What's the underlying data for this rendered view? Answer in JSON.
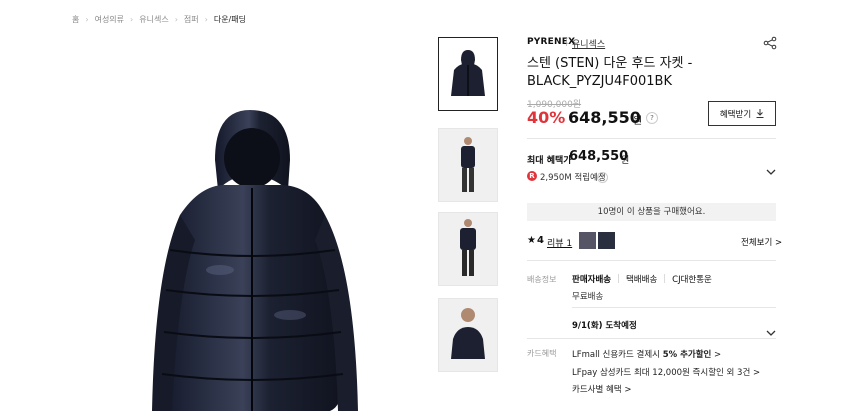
{
  "breadcrumb": [
    "홈",
    "여성의류",
    "유니섹스",
    "점퍼",
    "다운/패딩"
  ],
  "product": {
    "brand": "PYRENEX",
    "sub_brand": "유니섹스",
    "title": "스텐 (STEN) 다운 후드 자켓 - BLACK_PYZJU4F001BK",
    "original_price": "1,090,000원",
    "discount": "40%",
    "price": "648,550",
    "currency": "원"
  },
  "benefit_button": "혜택받기",
  "max_benefit": {
    "label": "최대 혜택가",
    "price": "648,550",
    "currency": "원"
  },
  "points": {
    "badge": "R",
    "text": "2,950M 적립예정"
  },
  "buyers_banner": "10명이 이 상품을 구매했어요.",
  "review": {
    "rating": "4",
    "link": "리뷰 1",
    "view_all": "전체보기 >"
  },
  "shipping": {
    "label": "배송정보",
    "seller": "판매자배송",
    "box": "택배배송",
    "carrier": "CJ대한통운",
    "fee": "무료배송",
    "arrival": "9/1(화) 도착예정"
  },
  "card_benefits": {
    "label": "카드혜택",
    "line1_prefix": "LFmall 신용카드 결제시 ",
    "line1_bold": "5% 추가할인",
    "line1_suffix": " >",
    "line2": "LFpay 삼성카드 최대 12,000원 즉시할인 외 3건 >",
    "line3": "카드사별 혜택 >"
  },
  "colors": {
    "discount_red": "#e0343b",
    "jacket": "#1c2030"
  }
}
